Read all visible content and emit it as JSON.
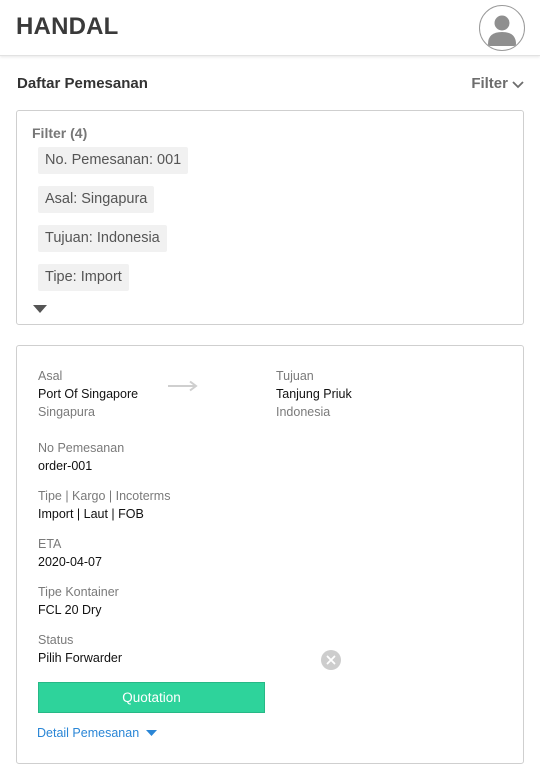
{
  "header": {
    "brand": "HANDAL",
    "avatar_icon": "user-avatar-icon"
  },
  "list": {
    "title": "Daftar Pemesanan",
    "filter_label": "Filter"
  },
  "filters": {
    "heading": "Filter (4)",
    "chips": [
      "No. Pemesanan: 001",
      "Asal: Singapura",
      "Tujuan: Indonesia",
      "Tipe: Import"
    ]
  },
  "order": {
    "origin_label": "Asal",
    "origin_port": "Port Of Singapore",
    "origin_country": "Singapura",
    "dest_label": "Tujuan",
    "dest_port": "Tanjung Priuk",
    "dest_country": "Indonesia",
    "order_no_label": "No Pemesanan",
    "order_no": "order-001",
    "type_label": "Tipe | Kargo | Incoterms",
    "type_value": "Import | Laut | FOB",
    "eta_label": "ETA",
    "eta_value": "2020-04-07",
    "container_label": "Tipe Kontainer",
    "container_value": "FCL 20 Dry",
    "status_label": "Status",
    "status_value": "Pilih Forwarder",
    "quotation_label": "Quotation",
    "detail_label": "Detail Pemesanan"
  },
  "colors": {
    "accent_green": "#2ed39b",
    "link_blue": "#2a86d6"
  }
}
